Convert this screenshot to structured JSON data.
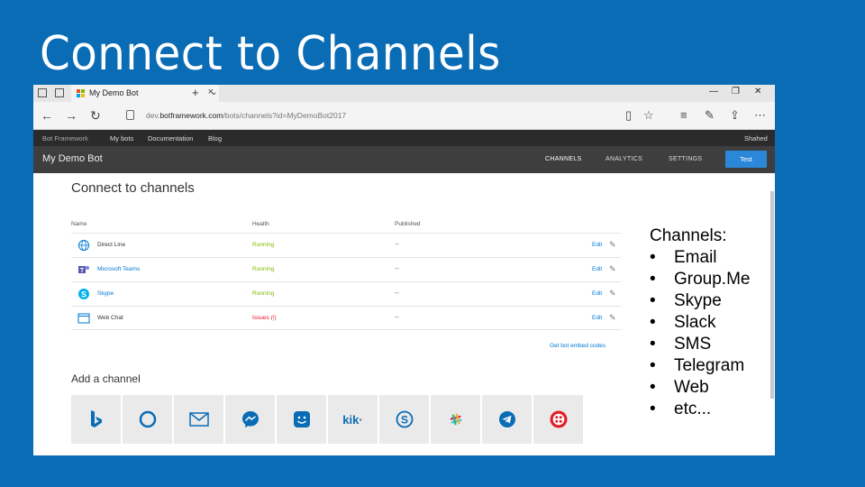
{
  "slide": {
    "title": "Connect to Channels"
  },
  "browser": {
    "tab_title": "My Demo Bot",
    "url_prefix": "dev.",
    "url_domain": "botframework.com",
    "url_path": "/bots/channels?id=MyDemoBot2017"
  },
  "site_nav": {
    "brand": "Bot Framework",
    "links": [
      "My bots",
      "Documentation",
      "Blog"
    ],
    "user": "Shahed"
  },
  "bot_bar": {
    "name": "My Demo Bot",
    "tabs": [
      "CHANNELS",
      "ANALYTICS",
      "SETTINGS"
    ],
    "test_label": "Test"
  },
  "page": {
    "heading": "Connect to channels",
    "columns": [
      "Name",
      "Health",
      "Published"
    ],
    "channels": [
      {
        "name": "Direct Line",
        "health": "Running",
        "published": "--",
        "edit": "Edit",
        "icon": "globe-icon",
        "link": false,
        "health_color": "#7fba00"
      },
      {
        "name": "Microsoft Teams",
        "health": "Running",
        "published": "--",
        "edit": "Edit",
        "icon": "teams-icon",
        "link": true,
        "health_color": "#7fba00"
      },
      {
        "name": "Skype",
        "health": "Running",
        "published": "--",
        "edit": "Edit",
        "icon": "skype-icon",
        "link": true,
        "health_color": "#7fba00"
      },
      {
        "name": "Web Chat",
        "health": "Issues (!)",
        "published": "--",
        "edit": "Edit",
        "icon": "webchat-icon",
        "link": false,
        "health_color": "#e81123"
      }
    ],
    "embed_link": "Get bot embed codes",
    "add_heading": "Add a channel",
    "add_tiles": [
      "bing-icon",
      "cortana-icon",
      "email-icon",
      "messenger-icon",
      "groupme-icon",
      "kik-icon",
      "skype-for-business-icon",
      "slack-icon",
      "telegram-icon",
      "twilio-icon"
    ],
    "kik_label": "kik·"
  },
  "overlay": {
    "heading": "Channels:",
    "bullet": "•",
    "items": [
      "Email",
      "Group.Me",
      "Skype",
      "Slack",
      "SMS",
      "Telegram",
      "Web",
      "etc..."
    ]
  }
}
